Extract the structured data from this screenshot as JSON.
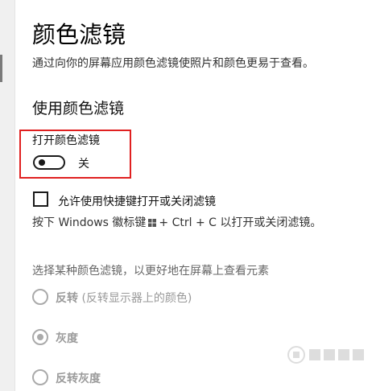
{
  "page": {
    "title": "颜色滤镜",
    "description": "通过向你的屏幕应用颜色滤镜使照片和颜色更易于查看。",
    "section_title": "使用颜色滤镜"
  },
  "toggle": {
    "label": "打开颜色滤镜",
    "state": "关"
  },
  "shortcut": {
    "checkbox_label": "允许使用快捷键打开或关闭滤镜",
    "hint_prefix": "按下 Windows 徽标键",
    "hint_suffix": "+ Ctrl + C 以打开或关闭滤镜。",
    "icon": "windows-logo-icon"
  },
  "filters": {
    "prompt": "选择某种颜色滤镜，以更好地在屏幕上查看元素",
    "options": [
      {
        "label": "反转",
        "detail": "(反转显示器上的颜色)",
        "selected": false
      },
      {
        "label": "灰度",
        "detail": "",
        "selected": true
      },
      {
        "label": "反转灰度",
        "detail": "",
        "selected": false
      }
    ]
  },
  "colors": {
    "highlight": "#e02020",
    "disabled": "#aaaaaa"
  }
}
